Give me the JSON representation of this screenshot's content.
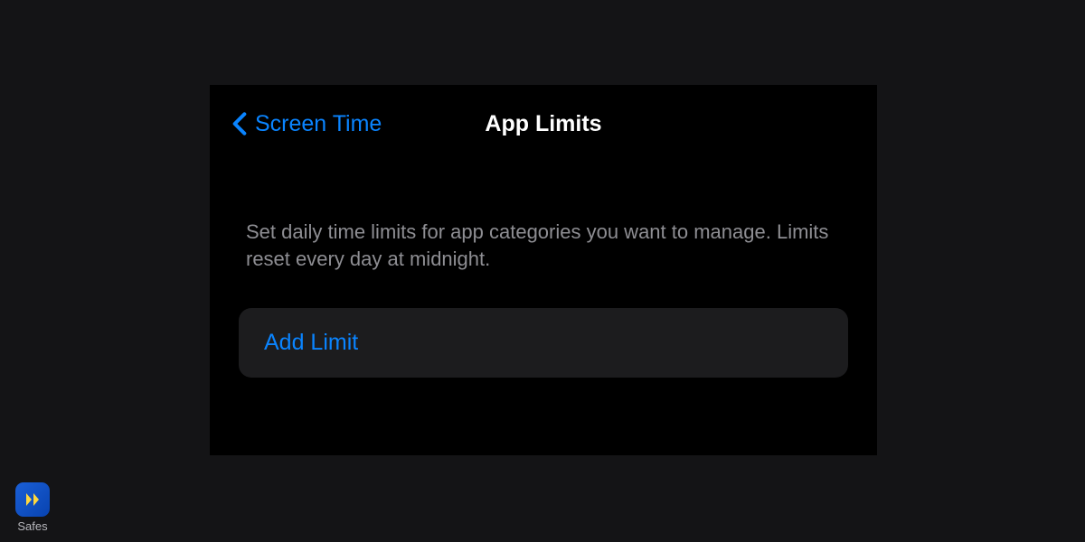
{
  "nav": {
    "back_label": "Screen Time",
    "title": "App Limits"
  },
  "description": "Set daily time limits for app categories you want to manage. Limits reset every day at midnight.",
  "action": {
    "add_limit_label": "Add Limit"
  },
  "watermark": {
    "label": "Safes"
  },
  "colors": {
    "accent": "#0a84ff",
    "panel_bg": "#000000",
    "page_bg": "#141416",
    "row_bg": "#1c1c1e",
    "secondary_text": "#8e8e93"
  }
}
